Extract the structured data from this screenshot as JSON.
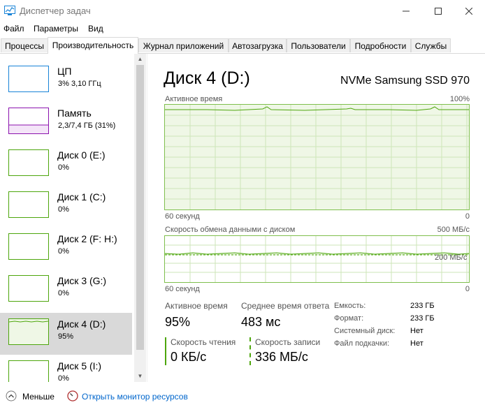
{
  "window": {
    "title": "Диспетчер задач"
  },
  "menu": [
    "Файл",
    "Параметры",
    "Вид"
  ],
  "tabs": [
    "Процессы",
    "Производительность",
    "Журнал приложений",
    "Автозагрузка",
    "Пользователи",
    "Подробности",
    "Службы"
  ],
  "active_tab": "Производительность",
  "resources": [
    {
      "name": "ЦП",
      "value": "3%  3,10 ГГц",
      "color": "#1883d7"
    },
    {
      "name": "Память",
      "value": "2,3/7,4 ГБ (31%)",
      "color": "#8b12ae"
    },
    {
      "name": "Диск 0 (E:)",
      "value": "0%",
      "color": "#4da60c"
    },
    {
      "name": "Диск 1 (C:)",
      "value": "0%",
      "color": "#4da60c"
    },
    {
      "name": "Диск 2 (F: H:)",
      "value": "0%",
      "color": "#4da60c"
    },
    {
      "name": "Диск 3 (G:)",
      "value": "0%",
      "color": "#4da60c"
    },
    {
      "name": "Диск 4 (D:)",
      "value": "95%",
      "color": "#4da60c"
    },
    {
      "name": "Диск 5 (I:)",
      "value": "0%",
      "color": "#4da60c"
    }
  ],
  "detail": {
    "title": "Диск 4 (D:)",
    "model": "NVMe Samsung SSD 970",
    "graph1": {
      "label": "Активное время",
      "max": "100%",
      "xleft": "60 секунд",
      "xright": "0"
    },
    "graph2": {
      "label": "Скорость обмена данными с диском",
      "max": "500 МБ/с",
      "mid": "200 МБ/с",
      "xleft": "60 секунд",
      "xright": "0"
    },
    "stats": {
      "active_time_label": "Активное время",
      "active_time": "95%",
      "avg_response_label": "Среднее время ответа",
      "avg_response": "483 мс",
      "read_label": "Скорость чтения",
      "read": "0 КБ/с",
      "write_label": "Скорость записи",
      "write": "336 МБ/с"
    },
    "properties": [
      {
        "label": "Емкость:",
        "value": "233 ГБ"
      },
      {
        "label": "Формат:",
        "value": "233 ГБ"
      },
      {
        "label": "Системный диск:",
        "value": "Нет"
      },
      {
        "label": "Файл подкачки:",
        "value": "Нет"
      }
    ]
  },
  "footer": {
    "fewer": "Меньше",
    "resmon": "Открыть монитор ресурсов"
  },
  "colors": {
    "disk": "#4da60c",
    "disk_fill": "#eff7e6",
    "grid": "#cde6b8",
    "link": "#0066cc"
  }
}
